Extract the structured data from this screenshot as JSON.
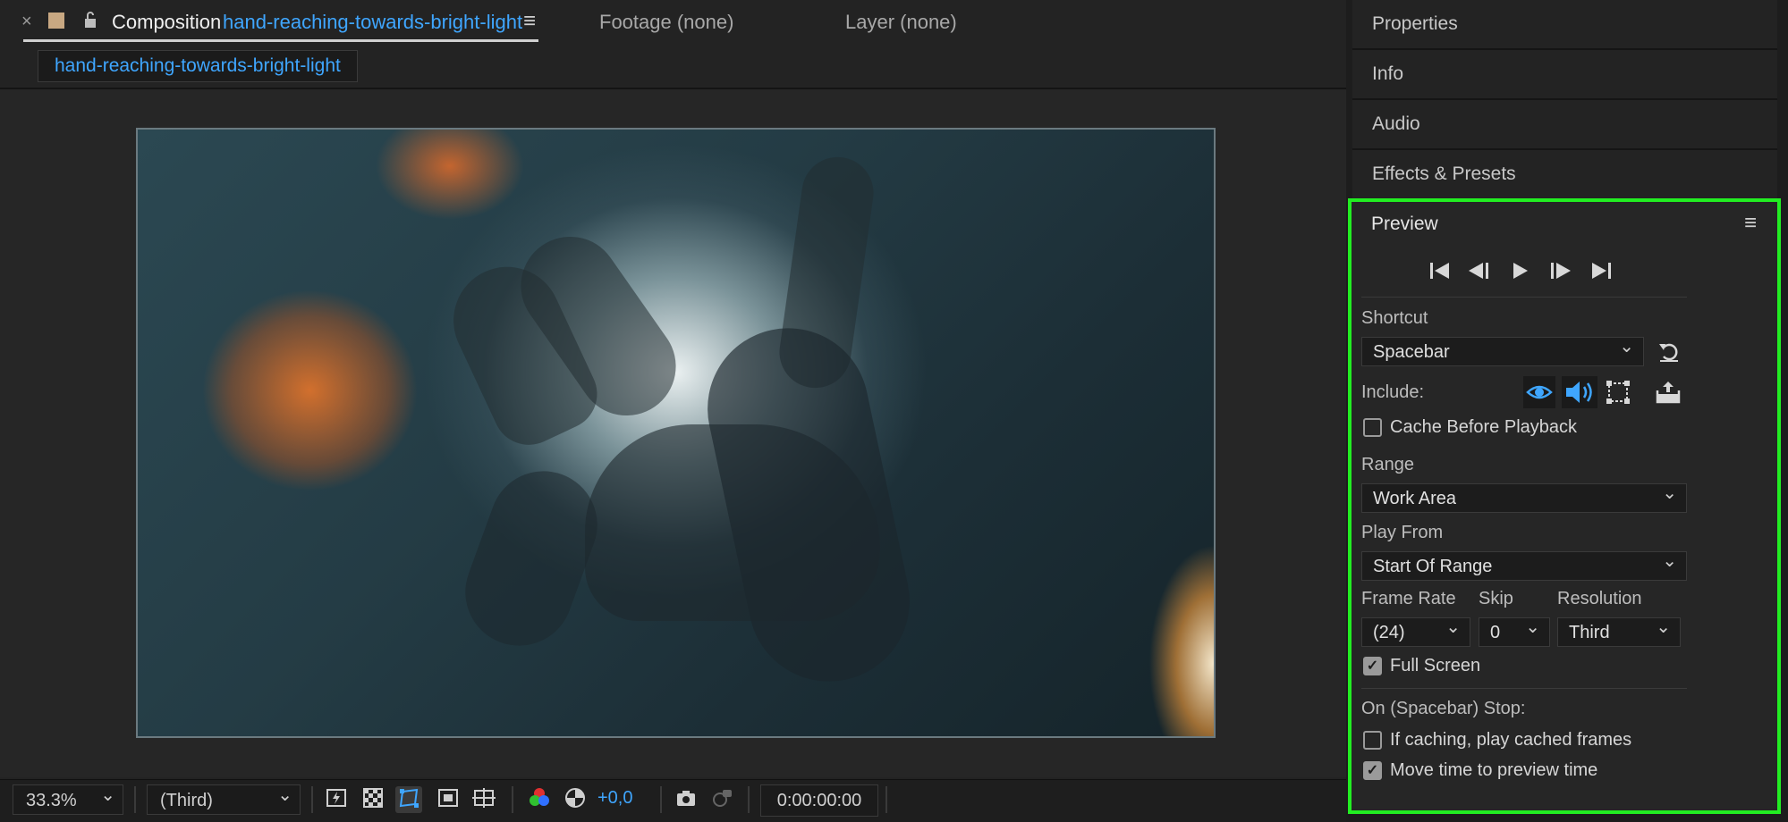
{
  "comp_panel": {
    "close_glyph": "×",
    "tab_label": "Composition",
    "comp_name": "hand-reaching-towards-bright-light",
    "menu_glyph": "≡",
    "footage_tab": "Footage (none)",
    "layer_tab": "Layer (none)",
    "comp_chip": "hand-reaching-towards-bright-light"
  },
  "bottom_bar": {
    "zoom": "33.3%",
    "resolution": "(Third)",
    "exposure": "+0,0",
    "timecode": "0:00:00:00",
    "chevron": "⌄"
  },
  "right_panels": {
    "properties": "Properties",
    "info": "Info",
    "audio": "Audio",
    "effects_presets": "Effects & Presets"
  },
  "preview": {
    "title": "Preview",
    "menu_glyph": "≡",
    "shortcut_label": "Shortcut",
    "shortcut_value": "Spacebar",
    "include_label": "Include:",
    "cache_before_playback": "Cache Before Playback",
    "range_label": "Range",
    "range_value": "Work Area",
    "play_from_label": "Play From",
    "play_from_value": "Start Of Range",
    "frame_rate_label": "Frame Rate",
    "frame_rate_value": "(24)",
    "skip_label": "Skip",
    "skip_value": "0",
    "resolution_label": "Resolution",
    "resolution_value": "Third",
    "full_screen": "Full Screen",
    "full_screen_checked": true,
    "on_stop_label": "On (Spacebar) Stop:",
    "if_caching": "If caching, play cached frames",
    "if_caching_checked": false,
    "move_time": "Move time to preview time",
    "move_time_checked": true,
    "checkmark": "✓",
    "chevron": "⌄"
  },
  "colors": {
    "accent_blue": "#3fa6ff",
    "highlight_green": "#22ee22"
  }
}
